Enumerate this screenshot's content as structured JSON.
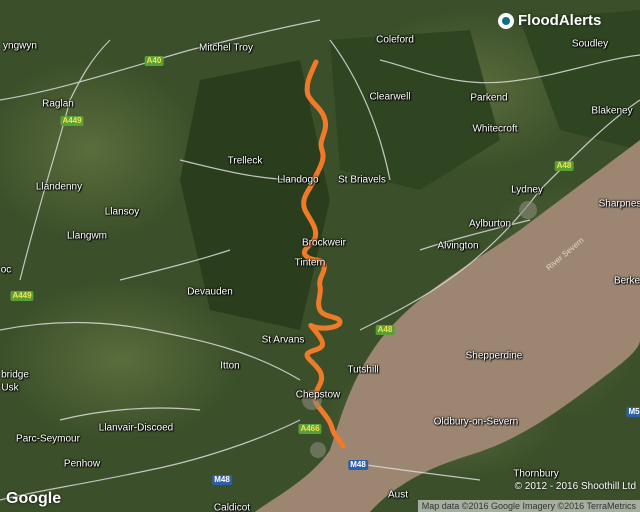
{
  "brand": {
    "name": "FloodAlerts"
  },
  "google_logo": "Google",
  "copyright": "© 2012 - 2016 Shoothill Ltd",
  "attribution": "Map data ©2016 Google  Imagery ©2016 TerraMetrics",
  "colors": {
    "river_highlight": "#f07a28",
    "estuary": "#9c8672",
    "forest": "#2f4a22",
    "road": "#dcdcdc",
    "a_road_shield": "#5aa03a",
    "motorway_shield": "#2f5fa8"
  },
  "places": {
    "mitchel_troy": "Mitchel Troy",
    "coleford": "Coleford",
    "soudley": "Soudley",
    "raglan": "Raglan",
    "clearwell": "Clearwell",
    "parkend": "Parkend",
    "blakeney": "Blakeney",
    "whitecroft": "Whitecroft",
    "trelleck": "Trelleck",
    "llandogo": "Llandogo",
    "st_briavels": "St Briavels",
    "llandenny": "Llandenny",
    "lydney": "Lydney",
    "sharpness": "Sharpnes",
    "llansoy": "Llansoy",
    "aylburton": "Aylburton",
    "brockweir": "Brockweir",
    "alvington": "Alvington",
    "tintern": "Tintern",
    "llangwm": "Llangwm",
    "berkeley": "Berke",
    "devauden": "Devauden",
    "st_arvans": "St Arvans",
    "tutshill": "Tutshill",
    "shepperdine": "Shepperdine",
    "itton": "Itton",
    "chepstow": "Chepstow",
    "usk": "Usk",
    "bridge": "bridge",
    "oc": "oc",
    "llanvair_discoed": "Llanvair-Discoed",
    "parc_seymour": "Parc-Seymour",
    "oldbury": "Oldbury-on-Severn",
    "penhow": "Penhow",
    "thornbury": "Thornbury",
    "aust": "Aust",
    "yngwyn": "yngwyn",
    "caldicot": "Caldicot",
    "river_severn": "River Severn"
  },
  "roads": {
    "a40": "A40",
    "a449_north": "A449",
    "a48_east": "A48",
    "a449_west": "A449",
    "a48_south": "A48",
    "a466": "A466",
    "m48_west": "M48",
    "m48_east": "M48",
    "m5": "M5"
  }
}
